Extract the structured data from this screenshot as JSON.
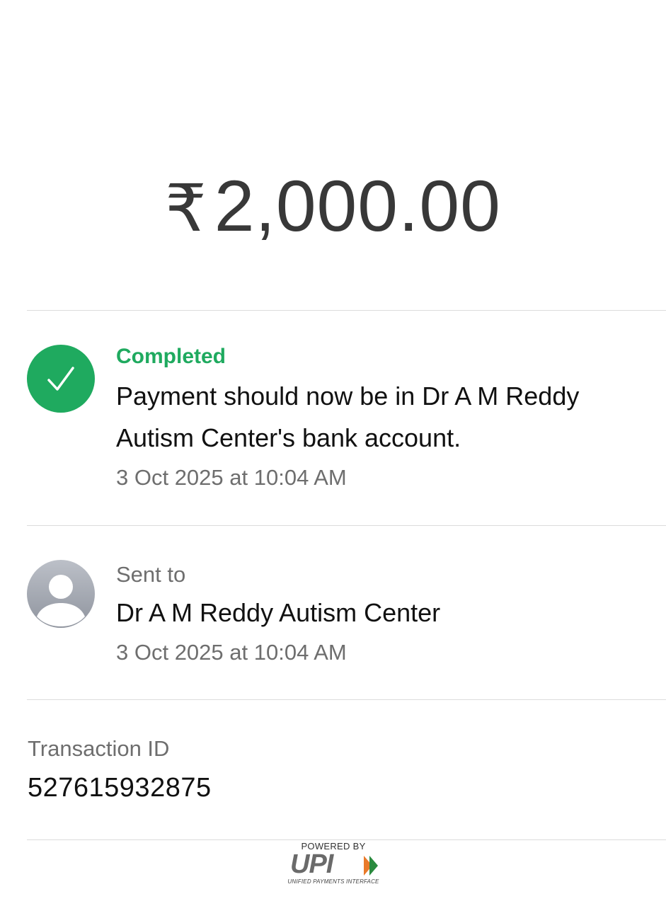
{
  "payment": {
    "currency_symbol": "₹",
    "amount": "2,000.00"
  },
  "status": {
    "label": "Completed",
    "message": "Payment should now be in Dr A M Reddy Autism Center's bank account.",
    "timestamp": "3 Oct 2025 at 10:04 AM",
    "color": "#1faa5f",
    "icon": "check-icon"
  },
  "recipient": {
    "label": "Sent to",
    "name": "Dr A M Reddy Autism Center",
    "timestamp": "3 Oct 2025 at 10:04 AM",
    "icon": "person-avatar-icon"
  },
  "transaction": {
    "label": "Transaction ID",
    "id": "527615932875"
  },
  "footer": {
    "powered_by": "POWERED BY",
    "brand": "UPI",
    "tagline": "UNIFIED PAYMENTS INTERFACE"
  }
}
